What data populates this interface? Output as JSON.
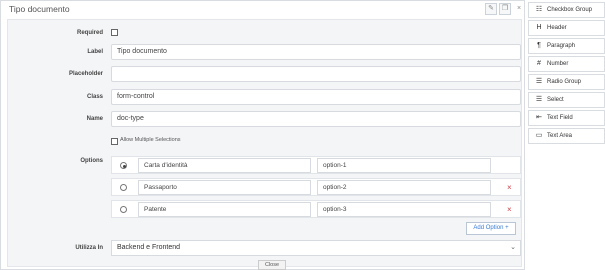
{
  "editor": {
    "title": "Tipo documento",
    "edit_icon": "pencil-icon",
    "copy_icon": "copy-icon",
    "close_icon": "close-icon",
    "close_glyph": "×",
    "fields": {
      "required": {
        "label": "Required",
        "checked": false
      },
      "label": {
        "label": "Label",
        "value": "Tipo documento"
      },
      "placeholder": {
        "label": "Placeholder",
        "value": ""
      },
      "class": {
        "label": "Class",
        "value": "form-control"
      },
      "name": {
        "label": "Name",
        "value": "doc-type"
      },
      "multiple": {
        "label": "Allow Multiple Selections",
        "checked": false
      },
      "options_label": "Options",
      "options": [
        {
          "label": "Carta d'identità",
          "value": "option-1",
          "selected": true,
          "remove": ""
        },
        {
          "label": "Passaporto",
          "value": "option-2",
          "selected": false,
          "remove": "×"
        },
        {
          "label": "Patente",
          "value": "option-3",
          "selected": false,
          "remove": "×"
        }
      ],
      "add_option": "Add Option +",
      "used_in": {
        "label": "Utilizza In",
        "value": "Backend e Frontend",
        "caret": "⌄"
      }
    },
    "close_button": "Close"
  },
  "sidebar": {
    "items": [
      {
        "label": "Checkbox Group",
        "icon": "checkbox-group-icon",
        "glyph": "☷"
      },
      {
        "label": "Header",
        "icon": "header-icon",
        "glyph": "H"
      },
      {
        "label": "Paragraph",
        "icon": "paragraph-icon",
        "glyph": "¶"
      },
      {
        "label": "Number",
        "icon": "number-icon",
        "glyph": "#"
      },
      {
        "label": "Radio Group",
        "icon": "radio-group-icon",
        "glyph": "☰"
      },
      {
        "label": "Select",
        "icon": "select-icon",
        "glyph": "☰"
      },
      {
        "label": "Text Field",
        "icon": "text-field-icon",
        "glyph": "⇤"
      },
      {
        "label": "Text Area",
        "icon": "text-area-icon",
        "glyph": "▭"
      }
    ]
  }
}
